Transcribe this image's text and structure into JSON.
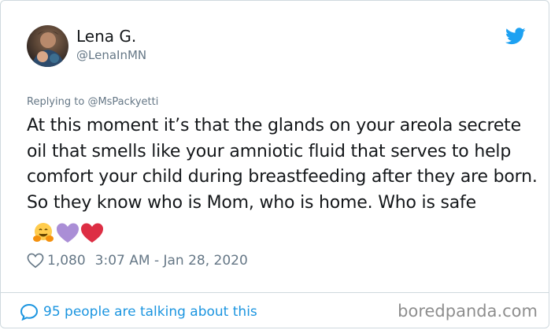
{
  "user": {
    "name": "Lena G.",
    "handle": "@LenaInMN"
  },
  "tweet": {
    "replying_prefix": "Replying to",
    "replying_to": "@MsPackyetti",
    "text": "At this moment it’s that the glands on your areola secrete oil that smells like your amniotic fluid that serves to help comfort your child during breastfeeding after they are born. So they know who is Mom, who is home. Who is safe",
    "emojis": [
      "hugging-face-emoji",
      "purple-heart-emoji",
      "red-heart-emoji"
    ],
    "likes": "1,080",
    "timestamp": "3:07 AM - Jan 28, 2020"
  },
  "footer": {
    "talking": "95 people are talking about this"
  },
  "watermark": "boredpanda.com",
  "colors": {
    "twitter_blue": "#1da1f2",
    "link_blue": "#1b95e0",
    "muted_gray": "#657786",
    "heart_red": "#e0245e",
    "purple_heart": "#aa8ed6"
  }
}
